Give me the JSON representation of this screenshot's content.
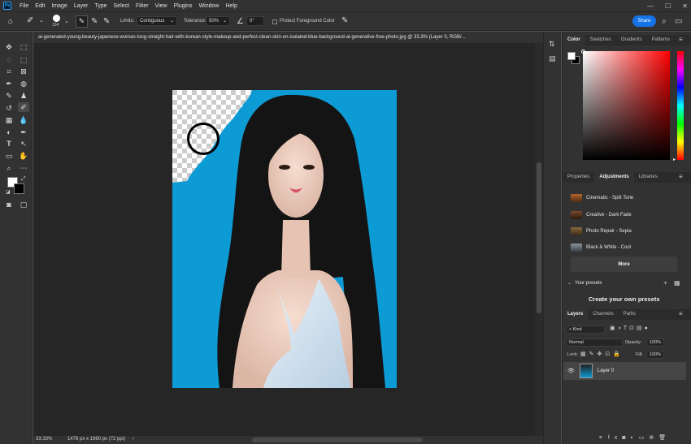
{
  "app": {
    "logo": "Ps"
  },
  "menu": [
    "File",
    "Edit",
    "Image",
    "Layer",
    "Type",
    "Select",
    "Filter",
    "View",
    "Plugins",
    "Window",
    "Help"
  ],
  "options": {
    "brush_size": "134",
    "limits_label": "Limits:",
    "limits_value": "Contiguous",
    "tolerance_label": "Tolerance:",
    "tolerance_value": "50%",
    "angle_value": "0°",
    "protect_label": "Protect Foreground Color",
    "share_label": "Share"
  },
  "document": {
    "tab_title": "ai-generated-young-beauty-japanese-woman-long-straight-hair-with-korean-style-makeup-and-perfect-clean-skin-on-isolated-blue-background-ai-generative-free-photo.jpg @ 33.3% (Layer 0, RGB/...",
    "zoom": "33.33%",
    "dimensions": "1476 px x 1960 px (72 ppi)"
  },
  "color_panel": {
    "tabs": [
      "Color",
      "Swatches",
      "Gradients",
      "Patterns"
    ],
    "foreground": "#ffffff",
    "background": "#000000",
    "hue": "#ff0000"
  },
  "adjustments_panel": {
    "tabs": [
      "Properties",
      "Adjustments",
      "Libraries"
    ],
    "presets": [
      {
        "name": "Cinematic - Split Tone",
        "color": "#b5652a"
      },
      {
        "name": "Creative - Dark Fade",
        "color": "#7a4a2a"
      },
      {
        "name": "Photo Repair - Sepia",
        "color": "#8a6a3e"
      },
      {
        "name": "Black & White - Cool",
        "color": "#6b7480"
      }
    ],
    "more_label": "More",
    "your_presets_label": "Your presets",
    "create_label": "Create your own presets"
  },
  "layers_panel": {
    "tabs": [
      "Layers",
      "Channels",
      "Paths"
    ],
    "kind_label": "Kind",
    "blend_mode": "Normal",
    "opacity_label": "Opacity:",
    "opacity_value": "100%",
    "lock_label": "Lock:",
    "fill_label": "Fill:",
    "fill_value": "100%",
    "layer_name": "Layer 0"
  }
}
